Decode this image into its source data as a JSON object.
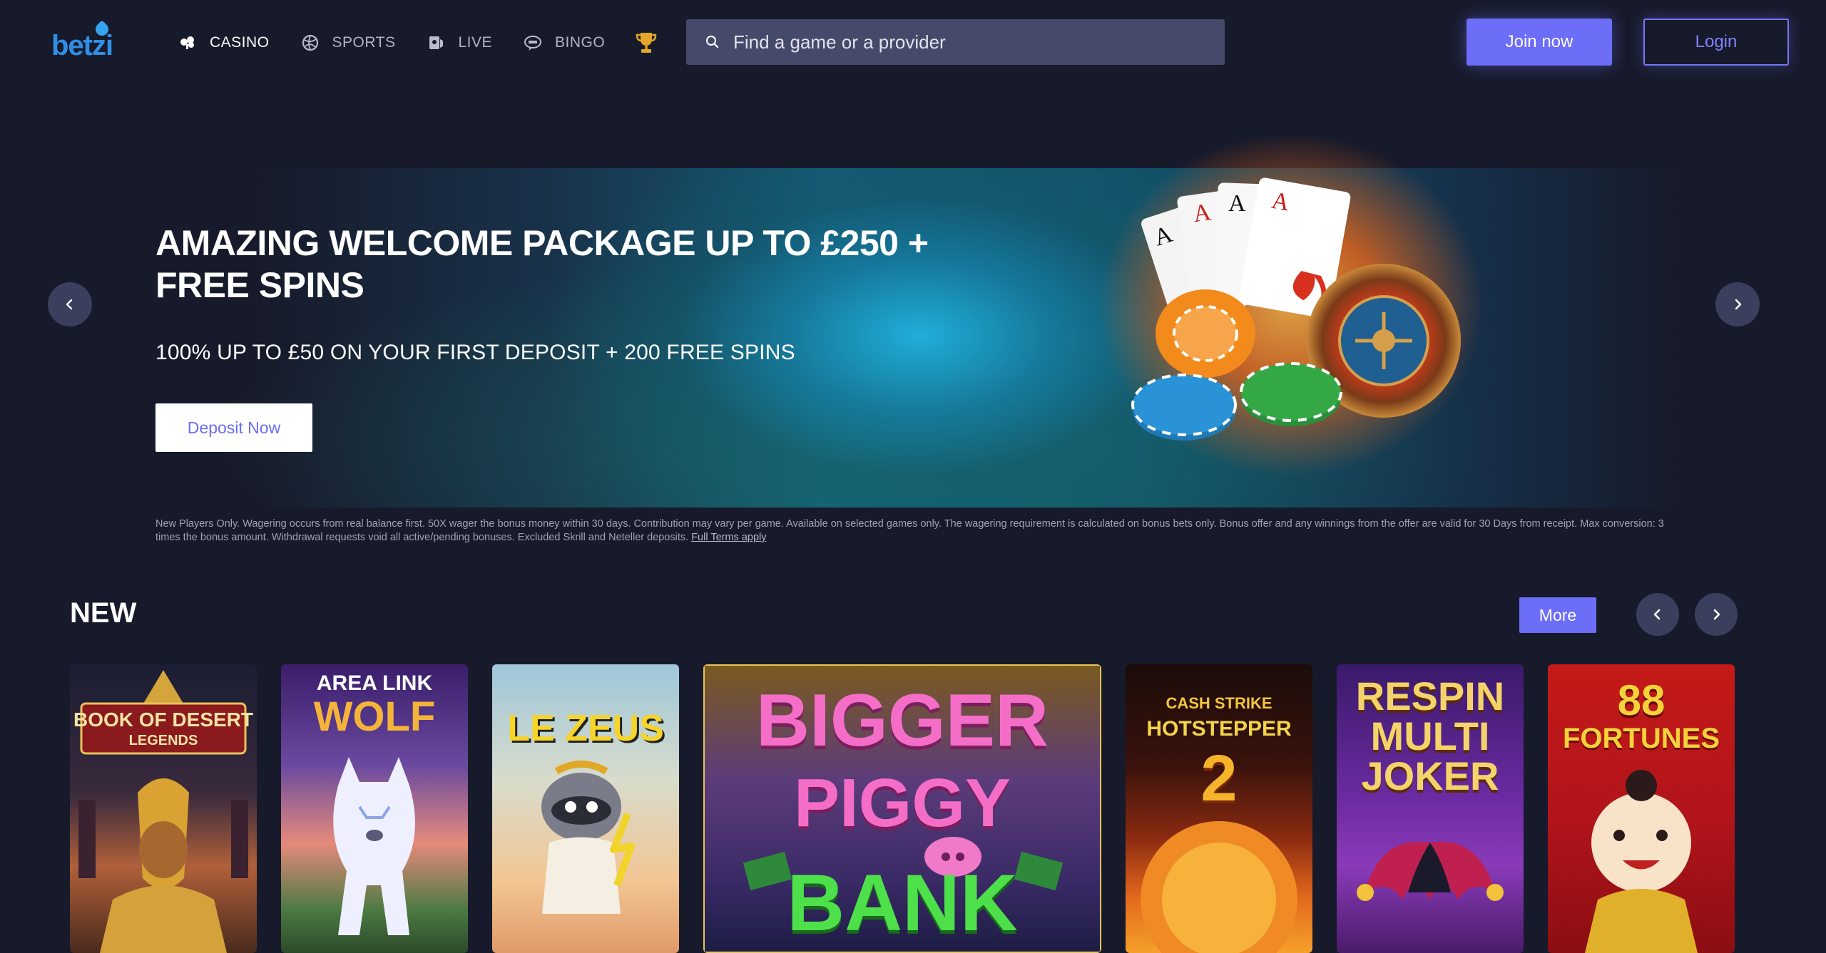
{
  "header": {
    "logo_text": "betzi",
    "nav": [
      {
        "label": "CASINO",
        "icon": "cards-icon"
      },
      {
        "label": "SPORTS",
        "icon": "ball-icon"
      },
      {
        "label": "LIVE",
        "icon": "live-dealer-icon"
      },
      {
        "label": "BINGO",
        "icon": "bingo-icon"
      }
    ],
    "trophy_icon": "trophy-icon",
    "search_placeholder": "Find a game or a provider",
    "join_label": "Join now",
    "login_label": "Login"
  },
  "hero": {
    "title": "AMAZING WELCOME PACKAGE UP TO £250 + FREE SPINS",
    "subtitle": "100% UP TO £50 ON YOUR FIRST DEPOSIT + 200 FREE SPINS",
    "cta_label": "Deposit Now",
    "terms": "New Players Only. Wagering occurs from real balance first. 50X wager the bonus money within 30 days. Contribution may vary per game. Available on selected games only. The wagering requirement is calculated on bonus bets only. Bonus offer and any winnings from the offer are valid for 30 Days from receipt. Max conversion: 3 times the bonus amount. Withdrawal requests void all active/pending bonuses. Excluded Skrill and Neteller deposits.",
    "terms_link": "Full Terms apply",
    "card_letters": [
      "A",
      "A",
      "A",
      "A"
    ]
  },
  "new_section": {
    "title": "NEW",
    "more_label": "More",
    "games": [
      {
        "line1": "BOOK OF DESERT",
        "line2": "LEGENDS"
      },
      {
        "line1": "AREA LINK",
        "line2": "WOLF"
      },
      {
        "line1": "LE ZEUS",
        "line2": ""
      },
      {
        "line1": "BIGGER",
        "line2": "PIGGY",
        "line3": "BANK"
      },
      {
        "line1": "CASH STRIKE",
        "line2": "HOTSTEPPER",
        "line3": "2"
      },
      {
        "line1": "RESPIN",
        "line2": "MULTI",
        "line3": "JOKER"
      },
      {
        "line1": "88",
        "line2": "FORTUNES"
      }
    ]
  },
  "colors": {
    "background": "#171a2a",
    "accent": "#6c6ef8",
    "search_bg": "#45496a"
  }
}
